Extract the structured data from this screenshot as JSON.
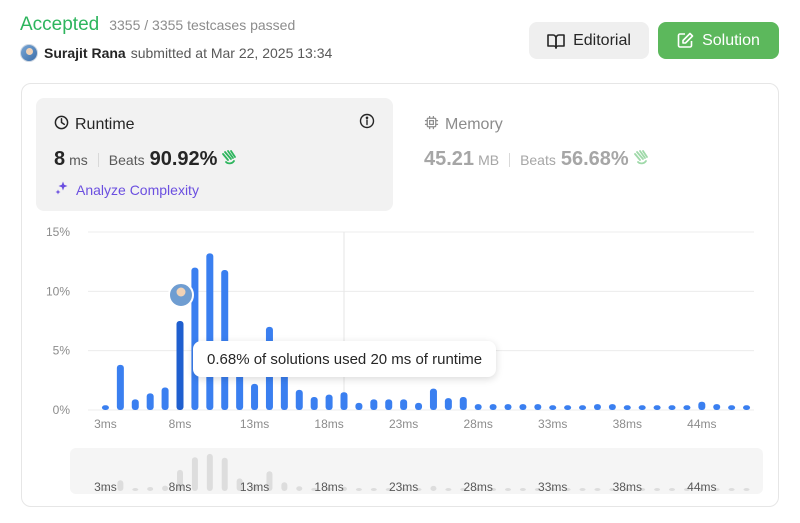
{
  "submission": {
    "status": "Accepted",
    "testcases": "3355 / 3355 testcases passed",
    "user": "Surajit Rana",
    "submitted_at": "submitted at Mar 22, 2025 13:34"
  },
  "buttons": {
    "editorial": "Editorial",
    "solution": "Solution"
  },
  "runtime": {
    "title": "Runtime",
    "value": "8",
    "unit": "ms",
    "beats_label": "Beats",
    "beats": "90.92%",
    "analyze": "Analyze Complexity"
  },
  "memory": {
    "title": "Memory",
    "value": "45.21",
    "unit": "MB",
    "beats_label": "Beats",
    "beats": "56.68%"
  },
  "tooltip": "0.68% of solutions used 20 ms of runtime",
  "colors": {
    "accepted": "#2db55d",
    "bar": "#3a7ff0",
    "bar_selected": "#1f5fcf",
    "solution_button": "#5cb85c",
    "analyze": "#6b4fe0"
  },
  "chart_data": {
    "type": "bar",
    "xlabel": "",
    "ylabel": "",
    "ylim": [
      0,
      15
    ],
    "yticks": [
      "0%",
      "5%",
      "10%",
      "15%"
    ],
    "x_tick_labels": [
      "3ms",
      "8ms",
      "13ms",
      "18ms",
      "23ms",
      "28ms",
      "33ms",
      "38ms",
      "44ms"
    ],
    "selected_index": 5,
    "hover_category": "20 ms",
    "values": [
      0.4,
      3.8,
      0.9,
      1.4,
      1.9,
      7.5,
      12.0,
      13.2,
      11.8,
      4.5,
      2.2,
      7.0,
      3.1,
      1.7,
      1.1,
      1.3,
      1.5,
      0.6,
      0.9,
      0.9,
      0.9,
      0.6,
      1.8,
      1.0,
      1.1,
      0.5,
      0.5,
      0.5,
      0.5,
      0.5,
      0.4,
      0.4,
      0.4,
      0.5,
      0.5,
      0.4,
      0.4,
      0.4,
      0.4,
      0.4,
      0.7,
      0.5,
      0.4,
      0.4
    ]
  }
}
